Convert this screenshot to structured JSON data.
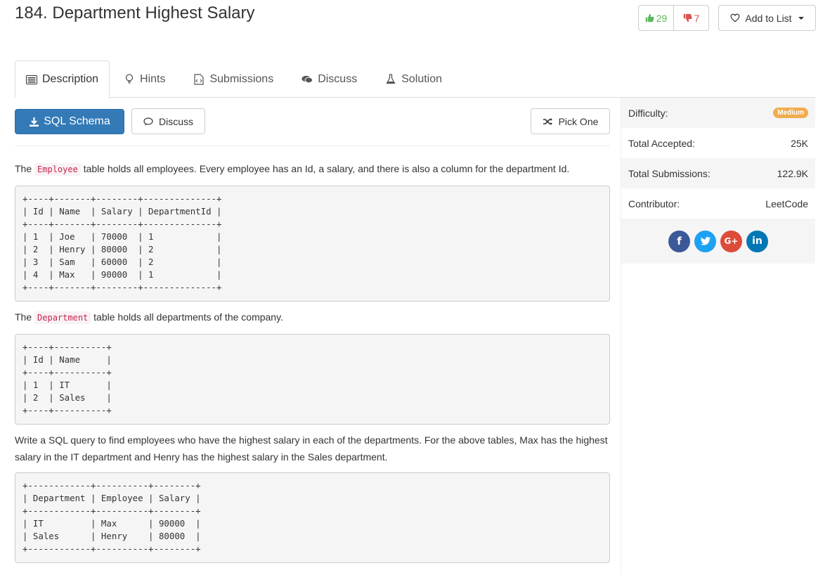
{
  "problem": {
    "title": "184. Department Highest Salary"
  },
  "votes": {
    "likes": "29",
    "dislikes": "7"
  },
  "add_list": {
    "label": "Add to List"
  },
  "tabs": [
    {
      "label": "Description",
      "icon": "description-icon"
    },
    {
      "label": "Hints",
      "icon": "lightbulb-icon"
    },
    {
      "label": "Submissions",
      "icon": "code-file-icon"
    },
    {
      "label": "Discuss",
      "icon": "comments-icon"
    },
    {
      "label": "Solution",
      "icon": "flask-icon"
    }
  ],
  "actions": {
    "schema_label": "SQL Schema",
    "discuss_label": "Discuss",
    "pick_label": "Pick One"
  },
  "description": {
    "p1_pre": "The ",
    "p1_code": "Employee",
    "p1_post": " table holds all employees. Every employee has an Id, a salary, and there is also a column for the department Id.",
    "employee_table": "+----+-------+--------+--------------+\n| Id | Name  | Salary | DepartmentId |\n+----+-------+--------+--------------+\n| 1  | Joe   | 70000  | 1            |\n| 2  | Henry | 80000  | 2            |\n| 3  | Sam   | 60000  | 2            |\n| 4  | Max   | 90000  | 1            |\n+----+-------+--------+--------------+",
    "p2_pre": "The ",
    "p2_code": "Department",
    "p2_post": " table holds all departments of the company.",
    "department_table": "+----+----------+\n| Id | Name     |\n+----+----------+\n| 1  | IT       |\n| 2  | Sales    |\n+----+----------+",
    "p3": "Write a SQL query to find employees who have the highest salary in each of the departments. For the above tables, Max has the highest salary in the IT department and Henry has the highest salary in the Sales department.",
    "result_table": "+------------+----------+--------+\n| Department | Employee | Salary |\n+------------+----------+--------+\n| IT         | Max      | 90000  |\n| Sales      | Henry    | 80000  |\n+------------+----------+--------+"
  },
  "sidebar": {
    "difficulty_label": "Difficulty:",
    "difficulty_value": "Medium",
    "accepted_label": "Total Accepted:",
    "accepted_value": "25K",
    "submissions_label": "Total Submissions:",
    "submissions_value": "122.9K",
    "contributor_label": "Contributor:",
    "contributor_value": "LeetCode"
  },
  "social": [
    {
      "name": "facebook-icon",
      "glyph": "f",
      "color": "#3b5998"
    },
    {
      "name": "twitter-icon",
      "glyph": "t",
      "color": "#1da1f2"
    },
    {
      "name": "google-plus-icon",
      "glyph": "G+",
      "color": "#dd4b39"
    },
    {
      "name": "linkedin-icon",
      "glyph": "in",
      "color": "#0077b5"
    }
  ]
}
